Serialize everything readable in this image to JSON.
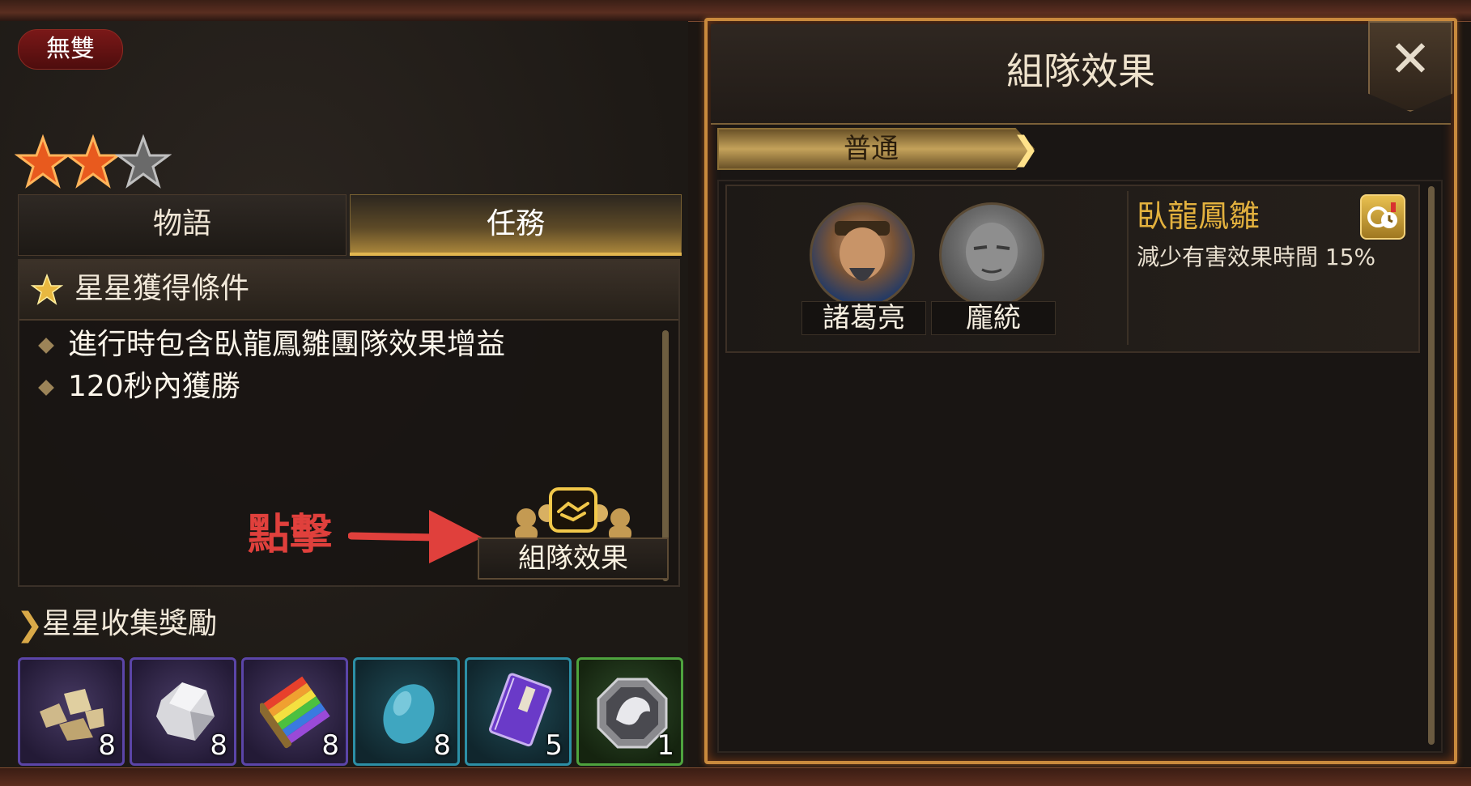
{
  "hero": {
    "badge": "無雙",
    "stars_earned": 2,
    "stars_total": 3
  },
  "tabs": [
    {
      "label": "物語",
      "active": false
    },
    {
      "label": "任務",
      "active": true
    }
  ],
  "conditions": {
    "title": "星星獲得條件",
    "items": [
      "進行時包含臥龍鳳雛團隊效果增益",
      "120秒內獲勝"
    ]
  },
  "annotation": {
    "click_label": "點擊"
  },
  "team_button": {
    "label": "組隊效果"
  },
  "rewards": {
    "title": "星星收集獎勵",
    "items": [
      {
        "icon": "gold-ore-icon",
        "count": "8",
        "rarity_color": "#5b45a8"
      },
      {
        "icon": "silver-ore-icon",
        "count": "8",
        "rarity_color": "#5b45a8"
      },
      {
        "icon": "rainbow-fabric-icon",
        "count": "8",
        "rarity_color": "#5b45a8"
      },
      {
        "icon": "blue-gem-icon",
        "count": "8",
        "rarity_color": "#2c8fa6"
      },
      {
        "icon": "purple-book-icon",
        "count": "5",
        "rarity_color": "#2c8fa6"
      },
      {
        "icon": "beast-emblem-icon",
        "count": "1",
        "rarity_color": "#4ea33e"
      }
    ]
  },
  "team_panel": {
    "title": "組隊效果",
    "filter_label": "普通",
    "entry": {
      "members": [
        "諸葛亮",
        "龐統"
      ],
      "combo_name": "臥龍鳳雛",
      "effect": "減少有害效果時間 15%"
    }
  },
  "colors": {
    "accent_gold": "#e3b13e",
    "frame_orange": "#c98a3d",
    "annotation_red": "#e0403c"
  }
}
